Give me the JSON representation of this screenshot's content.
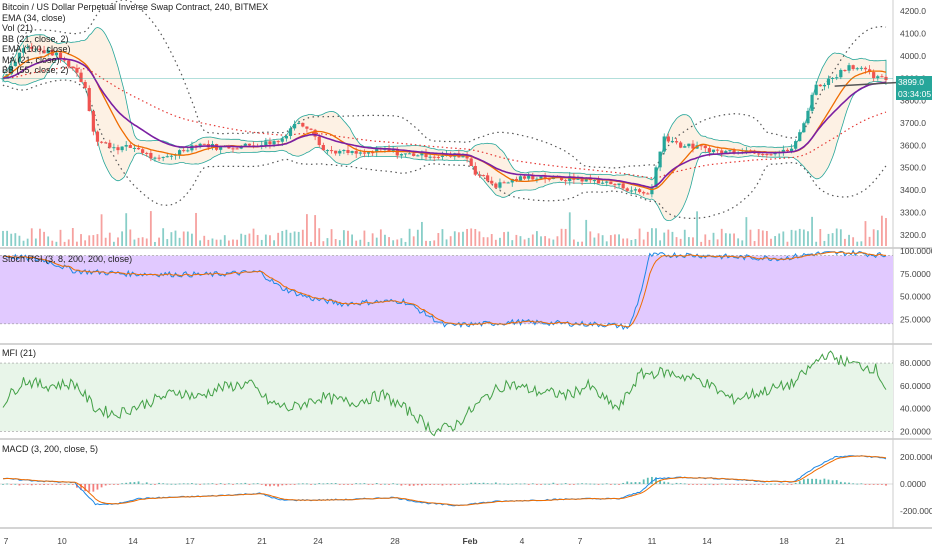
{
  "header": {
    "title": "Bitcoin / US Dollar Perpetual Inverse Swap Contract, 240, BITMEX"
  },
  "price_pane": {
    "legend": [
      "EMA (34, close)",
      "Vol (21)",
      "BB (21, close, 2)",
      "EMA (100, close)",
      "MA (21, close)",
      "BB (55, close, 2)"
    ],
    "axis_ticks": [
      "4200.0",
      "4100.0",
      "4000.0",
      "3900.0",
      "3800.0",
      "3700.0",
      "3600.0",
      "3500.0",
      "3400.0",
      "3300.0",
      "3200.0"
    ],
    "last_price": "3899.0",
    "countdown": "03:34:05",
    "colors": {
      "up": "#26a69a",
      "down": "#ef5350",
      "ema": "#7b1fa2",
      "ma": "#ef6c00",
      "bb_fill": "#fdf1e4",
      "tag": "#26a69a"
    }
  },
  "stoch_pane": {
    "legend": "Stoch RSI (3, 8, 200, 200, close)",
    "axis_ticks": [
      "100.0000",
      "75.0000",
      "50.0000",
      "25.0000"
    ],
    "band_color": "#e1c9ff"
  },
  "mfi_pane": {
    "legend": "MFI (21)",
    "axis_ticks": [
      "80.0000",
      "60.0000",
      "40.0000",
      "20.0000"
    ],
    "band_color": "#e8f5e9"
  },
  "macd_pane": {
    "legend": "MACD (3, 200, close, 5)",
    "axis_ticks": [
      "200.0000",
      "0.0000",
      "-200.0000"
    ]
  },
  "time_axis": [
    "7",
    "10",
    "14",
    "17",
    "21",
    "24",
    "28",
    "Feb",
    "4",
    "7",
    "11",
    "14",
    "18",
    "21"
  ],
  "chart_data": {
    "type": "candlestick",
    "price": {
      "ylim": [
        3150,
        4250
      ],
      "close_keypoints": [
        [
          0,
          3900
        ],
        [
          10,
          4040
        ],
        [
          25,
          4010
        ],
        [
          35,
          3940
        ],
        [
          40,
          3860
        ],
        [
          45,
          3620
        ],
        [
          55,
          3590
        ],
        [
          65,
          3590
        ],
        [
          75,
          3530
        ],
        [
          85,
          3570
        ],
        [
          95,
          3610
        ],
        [
          105,
          3590
        ],
        [
          120,
          3600
        ],
        [
          135,
          3620
        ],
        [
          142,
          3700
        ],
        [
          150,
          3680
        ],
        [
          156,
          3580
        ],
        [
          165,
          3570
        ],
        [
          175,
          3560
        ],
        [
          185,
          3580
        ],
        [
          195,
          3560
        ],
        [
          205,
          3560
        ],
        [
          215,
          3550
        ],
        [
          225,
          3560
        ],
        [
          230,
          3480
        ],
        [
          240,
          3420
        ],
        [
          250,
          3450
        ],
        [
          260,
          3460
        ],
        [
          270,
          3450
        ],
        [
          280,
          3450
        ],
        [
          290,
          3440
        ],
        [
          300,
          3420
        ],
        [
          310,
          3390
        ],
        [
          315,
          3380
        ],
        [
          318,
          3500
        ],
        [
          322,
          3640
        ],
        [
          330,
          3600
        ],
        [
          340,
          3590
        ],
        [
          350,
          3570
        ],
        [
          360,
          3580
        ],
        [
          370,
          3570
        ],
        [
          380,
          3570
        ],
        [
          385,
          3590
        ],
        [
          390,
          3700
        ],
        [
          395,
          3860
        ],
        [
          400,
          3880
        ],
        [
          405,
          3910
        ],
        [
          412,
          3960
        ],
        [
          418,
          3940
        ],
        [
          425,
          3900
        ],
        [
          430,
          3895
        ]
      ],
      "volume_note": "volume bars along bottom of price pane"
    },
    "stoch_rsi": {
      "ylim": [
        0,
        100
      ],
      "keypoints": [
        [
          0,
          95
        ],
        [
          20,
          90
        ],
        [
          35,
          78
        ],
        [
          60,
          75
        ],
        [
          100,
          74
        ],
        [
          125,
          77
        ],
        [
          135,
          60
        ],
        [
          150,
          48
        ],
        [
          165,
          42
        ],
        [
          180,
          44
        ],
        [
          195,
          45
        ],
        [
          205,
          32
        ],
        [
          215,
          18
        ],
        [
          235,
          20
        ],
        [
          250,
          22
        ],
        [
          280,
          20
        ],
        [
          295,
          19
        ],
        [
          305,
          16
        ],
        [
          310,
          50
        ],
        [
          315,
          95
        ],
        [
          330,
          96
        ],
        [
          360,
          93
        ],
        [
          380,
          92
        ],
        [
          395,
          97
        ],
        [
          415,
          98
        ],
        [
          430,
          95
        ]
      ]
    },
    "mfi": {
      "ylim": [
        15,
        95
      ],
      "keypoints": [
        [
          0,
          45
        ],
        [
          10,
          65
        ],
        [
          20,
          60
        ],
        [
          35,
          62
        ],
        [
          45,
          40
        ],
        [
          55,
          35
        ],
        [
          70,
          45
        ],
        [
          85,
          55
        ],
        [
          95,
          50
        ],
        [
          105,
          58
        ],
        [
          120,
          62
        ],
        [
          130,
          45
        ],
        [
          140,
          40
        ],
        [
          155,
          50
        ],
        [
          170,
          45
        ],
        [
          185,
          52
        ],
        [
          200,
          35
        ],
        [
          210,
          20
        ],
        [
          220,
          25
        ],
        [
          235,
          50
        ],
        [
          245,
          62
        ],
        [
          260,
          55
        ],
        [
          275,
          52
        ],
        [
          285,
          60
        ],
        [
          295,
          45
        ],
        [
          300,
          40
        ],
        [
          310,
          70
        ],
        [
          322,
          72
        ],
        [
          340,
          65
        ],
        [
          355,
          48
        ],
        [
          370,
          55
        ],
        [
          385,
          62
        ],
        [
          400,
          88
        ],
        [
          412,
          80
        ],
        [
          425,
          75
        ],
        [
          430,
          58
        ]
      ]
    },
    "macd": {
      "ylim": [
        -320,
        320
      ],
      "keypoints": [
        [
          0,
          40
        ],
        [
          20,
          20
        ],
        [
          35,
          10
        ],
        [
          45,
          -150
        ],
        [
          55,
          -150
        ],
        [
          65,
          -110
        ],
        [
          80,
          -100
        ],
        [
          100,
          -90
        ],
        [
          125,
          -70
        ],
        [
          135,
          -120
        ],
        [
          150,
          -120
        ],
        [
          170,
          -115
        ],
        [
          190,
          -100
        ],
        [
          205,
          -140
        ],
        [
          220,
          -160
        ],
        [
          240,
          -130
        ],
        [
          260,
          -120
        ],
        [
          280,
          -110
        ],
        [
          300,
          -110
        ],
        [
          310,
          -60
        ],
        [
          318,
          40
        ],
        [
          330,
          50
        ],
        [
          350,
          40
        ],
        [
          370,
          20
        ],
        [
          385,
          15
        ],
        [
          395,
          120
        ],
        [
          405,
          200
        ],
        [
          415,
          210
        ],
        [
          425,
          200
        ],
        [
          430,
          190
        ]
      ]
    }
  }
}
